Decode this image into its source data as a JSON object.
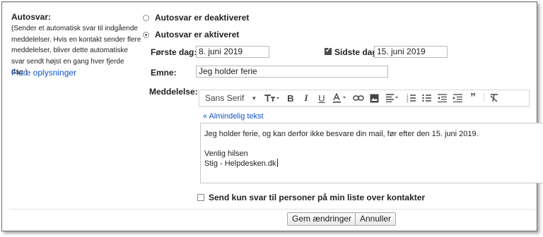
{
  "left": {
    "title": "Autosvar:",
    "description": "(Sender et automatisk svar til indgående meddelelser. Hvis en kontakt sender flere meddelelser, bliver dette automatiske svar sendt højst en gang hver fjerde dag.)",
    "link": "Flere oplysninger"
  },
  "autoreply": {
    "off_label": "Autosvar er deaktiveret",
    "on_label": "Autosvar er aktiveret",
    "selected": "on"
  },
  "dates": {
    "first_label": "Første dag:",
    "first_value": "8. juni 2019",
    "last_label": "Sidste dag:",
    "last_value": "15. juni 2019",
    "last_checked": true
  },
  "subject": {
    "label": "Emne:",
    "value": "Jeg holder ferie"
  },
  "message": {
    "label": "Meddelelse:",
    "font": "Sans Serif",
    "plain_text_link": "« Almindelig tekst",
    "lines": [
      "Jeg holder ferie, og kan derfor ikke besvare din mail, før efter den 15. juni 2019.",
      "",
      "Venlig hilsen",
      "Stig - Helpdesken.dk"
    ]
  },
  "contacts_only": {
    "label": "Send kun svar til personer på min liste over kontakter",
    "checked": false
  },
  "buttons": {
    "save": "Gem ændringer",
    "cancel": "Annuller"
  },
  "icons": [
    "text-size-icon",
    "bold-icon",
    "italic-icon",
    "underline-icon",
    "text-color-icon",
    "link-icon",
    "image-icon",
    "align-icon",
    "numbered-list-icon",
    "bulleted-list-icon",
    "indent-less-icon",
    "indent-more-icon",
    "quote-icon",
    "remove-formatting-icon"
  ]
}
